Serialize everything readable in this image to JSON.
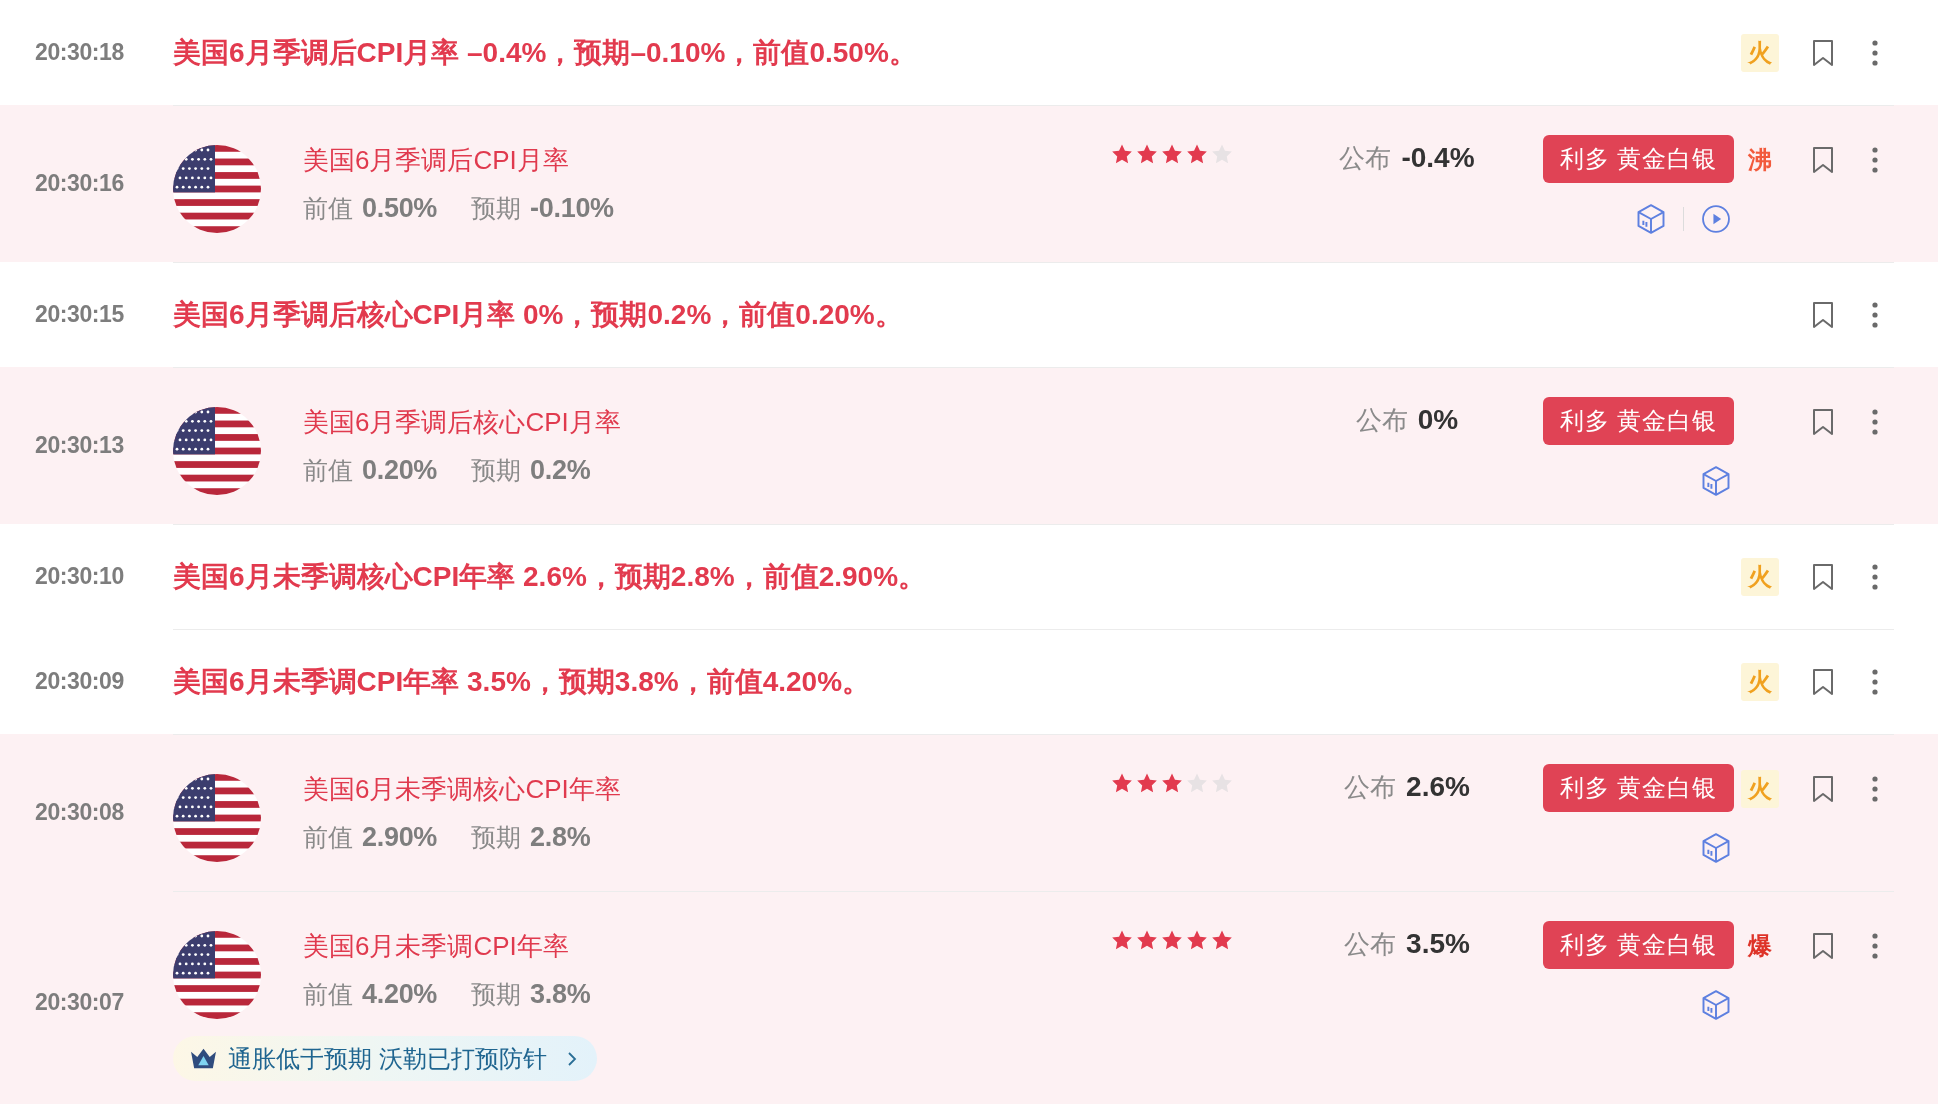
{
  "feed": [
    {
      "kind": "flash",
      "time": "20:30:18",
      "text": "美国6月季调后CPI月率 –0.4%，预期–0.10%，前值0.50%。",
      "heat": {
        "kind": "fire",
        "label": "火"
      }
    },
    {
      "kind": "data",
      "time": "20:30:16",
      "title": "美国6月季调后CPI月率",
      "previous": {
        "label": "前值",
        "value": "0.50%"
      },
      "forecast": {
        "label": "预期",
        "value": "-0.10%"
      },
      "stars": 4,
      "actual": {
        "label": "公布",
        "value": "-0.4%"
      },
      "impact": "利多 黄金白银",
      "video": true,
      "heat": {
        "kind": "boil",
        "label": "沸"
      }
    },
    {
      "kind": "flash",
      "time": "20:30:15",
      "text": "美国6月季调后核心CPI月率 0%，预期0.2%，前值0.20%。"
    },
    {
      "kind": "data",
      "time": "20:30:13",
      "title": "美国6月季调后核心CPI月率",
      "previous": {
        "label": "前值",
        "value": "0.20%"
      },
      "forecast": {
        "label": "预期",
        "value": "0.2%"
      },
      "actual": {
        "label": "公布",
        "value": "0%"
      },
      "impact": "利多 黄金白银",
      "video": false
    },
    {
      "kind": "flash",
      "time": "20:30:10",
      "text": "美国6月未季调核心CPI年率 2.6%，预期2.8%，前值2.90%。",
      "heat": {
        "kind": "fire",
        "label": "火"
      }
    },
    {
      "kind": "flash",
      "time": "20:30:09",
      "text": "美国6月未季调CPI年率 3.5%，预期3.8%，前值4.20%。",
      "heat": {
        "kind": "fire",
        "label": "火"
      }
    },
    {
      "kind": "data",
      "time": "20:30:08",
      "title": "美国6月未季调核心CPI年率",
      "previous": {
        "label": "前值",
        "value": "2.90%"
      },
      "forecast": {
        "label": "预期",
        "value": "2.8%"
      },
      "stars": 3,
      "actual": {
        "label": "公布",
        "value": "2.6%"
      },
      "impact": "利多 黄金白银",
      "video": false,
      "heat": {
        "kind": "fire",
        "label": "火"
      }
    },
    {
      "kind": "data",
      "time": "20:30:07",
      "title": "美国6月未季调CPI年率",
      "previous": {
        "label": "前值",
        "value": "4.20%"
      },
      "forecast": {
        "label": "预期",
        "value": "3.8%"
      },
      "stars": 5,
      "actual": {
        "label": "公布",
        "value": "3.5%"
      },
      "impact": "利多 黄金白银",
      "video": false,
      "heat": {
        "kind": "burst",
        "label": "爆"
      },
      "tag": "通胀低于预期 沃勒已打预防针"
    }
  ]
}
